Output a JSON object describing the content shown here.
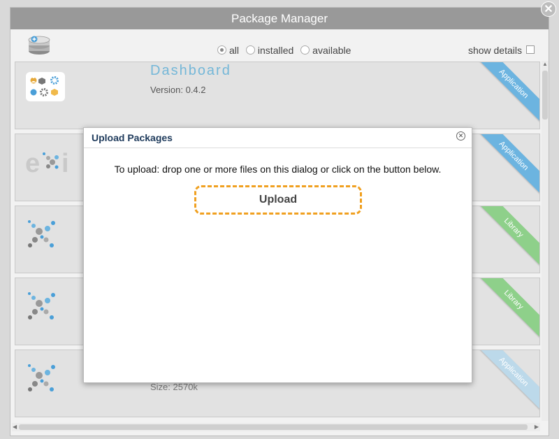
{
  "window": {
    "title": "Package Manager"
  },
  "toolbar": {
    "filters": [
      {
        "label": "all",
        "selected": true
      },
      {
        "label": "installed",
        "selected": false
      },
      {
        "label": "available",
        "selected": false
      }
    ],
    "show_details_label": "show details",
    "show_details_checked": false
  },
  "packages": [
    {
      "name": "Dashboard",
      "version": "Version: 0.4.2",
      "type": "Application",
      "type_color": "#6cb4e0"
    },
    {
      "name": "",
      "version": "",
      "type": "Application",
      "type_color": "#6cb4e0"
    },
    {
      "name": "",
      "version": "",
      "type": "Library",
      "type_color": "#8ed08a"
    },
    {
      "name": "",
      "version": "",
      "type": "Library",
      "type_color": "#8ed08a"
    },
    {
      "name": "",
      "size": "Size: 2570k",
      "type": "Application",
      "type_color": "#bcd9ea"
    }
  ],
  "dialog": {
    "title": "Upload Packages",
    "instructions": "To upload: drop one or more files on this dialog or click on the button below.",
    "upload_label": "Upload"
  }
}
